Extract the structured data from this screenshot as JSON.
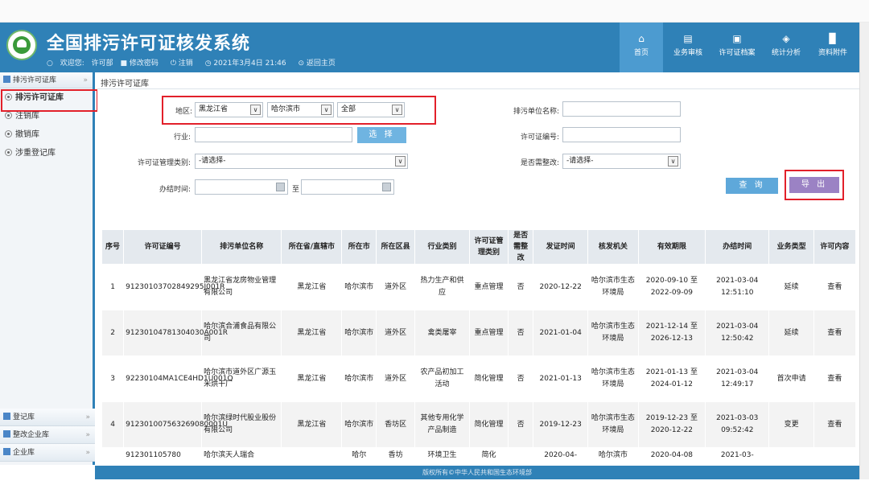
{
  "app": {
    "title": "全国排污许可证核发系统",
    "user_items": [
      "欢迎您:",
      "许可部",
      "修改密码",
      "注销",
      "2021年3月4日 21:46",
      "返回主页"
    ]
  },
  "topnav": [
    "首页",
    "业务审核",
    "许可证档案",
    "统计分析",
    "资料附件"
  ],
  "sidebar": {
    "group_top": "排污许可证库",
    "items": [
      "排污许可证库",
      "注销库",
      "撤销库",
      "涉重登记库"
    ],
    "groups_bottom": [
      "登记库",
      "整改企业库",
      "企业库"
    ]
  },
  "breadcrumb": "排污许可证库",
  "form": {
    "region_label": "地区:",
    "province": "黑龙江省",
    "city": "哈尔滨市",
    "district": "全部",
    "unit_name_label": "排污单位名称:",
    "industry_label": "行业:",
    "select_button": "选 择",
    "license_no_label": "许可证编号:",
    "category_label": "许可证管理类别:",
    "category_value": "-请选择-",
    "rectify_label": "是否需整改:",
    "rectify_value": "-请选择-",
    "time_label": "办结时间:",
    "to": "至",
    "query_button": "查 询",
    "export_button": "导 出"
  },
  "table": {
    "headers": [
      "序号",
      "许可证编号",
      "排污单位名称",
      "所在省/直辖市",
      "所在市",
      "所在区县",
      "行业类别",
      "许可证管理类别",
      "是否需整改",
      "发证时间",
      "核发机关",
      "有效期限",
      "办结时间",
      "业务类型",
      "许可内容"
    ],
    "rows": [
      [
        "1",
        "91230103702849295J001R",
        "黑龙江省龙房物业管理有限公司",
        "黑龙江省",
        "哈尔滨市",
        "道外区",
        "热力生产和供应",
        "重点管理",
        "否",
        "2020-12-22",
        "哈尔滨市生态环境局",
        "2020-09-10 至 2022-09-09",
        "2021-03-04 12:51:10",
        "延续",
        "查看"
      ],
      [
        "2",
        "91230104781304030A001R",
        "哈尔滨合浦食品有限公司",
        "黑龙江省",
        "哈尔滨市",
        "道外区",
        "禽类屠宰",
        "重点管理",
        "否",
        "2021-01-04",
        "哈尔滨市生态环境局",
        "2021-12-14 至 2026-12-13",
        "2021-03-04 12:50:42",
        "延续",
        "查看"
      ],
      [
        "3",
        "92230104MA1CE4HD1U001Q",
        "哈尔滨市道外区广源玉米烘干厂",
        "黑龙江省",
        "哈尔滨市",
        "道外区",
        "农产品初加工活动",
        "简化管理",
        "否",
        "2021-01-13",
        "哈尔滨市生态环境局",
        "2021-01-13 至 2024-01-12",
        "2021-03-04 12:49:17",
        "首次申请",
        "查看"
      ],
      [
        "4",
        "912301007563269080001U",
        "哈尔滨绿时代股业股份有限公司",
        "黑龙江省",
        "哈尔滨市",
        "香坊区",
        "其他专用化学产品制造",
        "简化管理",
        "否",
        "2019-12-23",
        "哈尔滨市生态环境局",
        "2019-12-23 至 2020-12-22",
        "2021-03-03 09:52:42",
        "变更",
        "查看"
      ],
      [
        "",
        "912301105780",
        "哈尔滨天人瑞合",
        "",
        "哈尔",
        "香坊",
        "环境卫生",
        "简化",
        "",
        "2020-04-",
        "哈尔滨市",
        "2020-04-08",
        "2021-03-",
        "",
        ""
      ]
    ]
  },
  "footer": "版权所有©中华人民共和国生态环境部",
  "colors": {
    "header": "#2f81b7",
    "query_button": "#5ea8da",
    "export_button": "#9b82c4",
    "highlight": "#e2202a",
    "link": "#1a4fb6"
  }
}
